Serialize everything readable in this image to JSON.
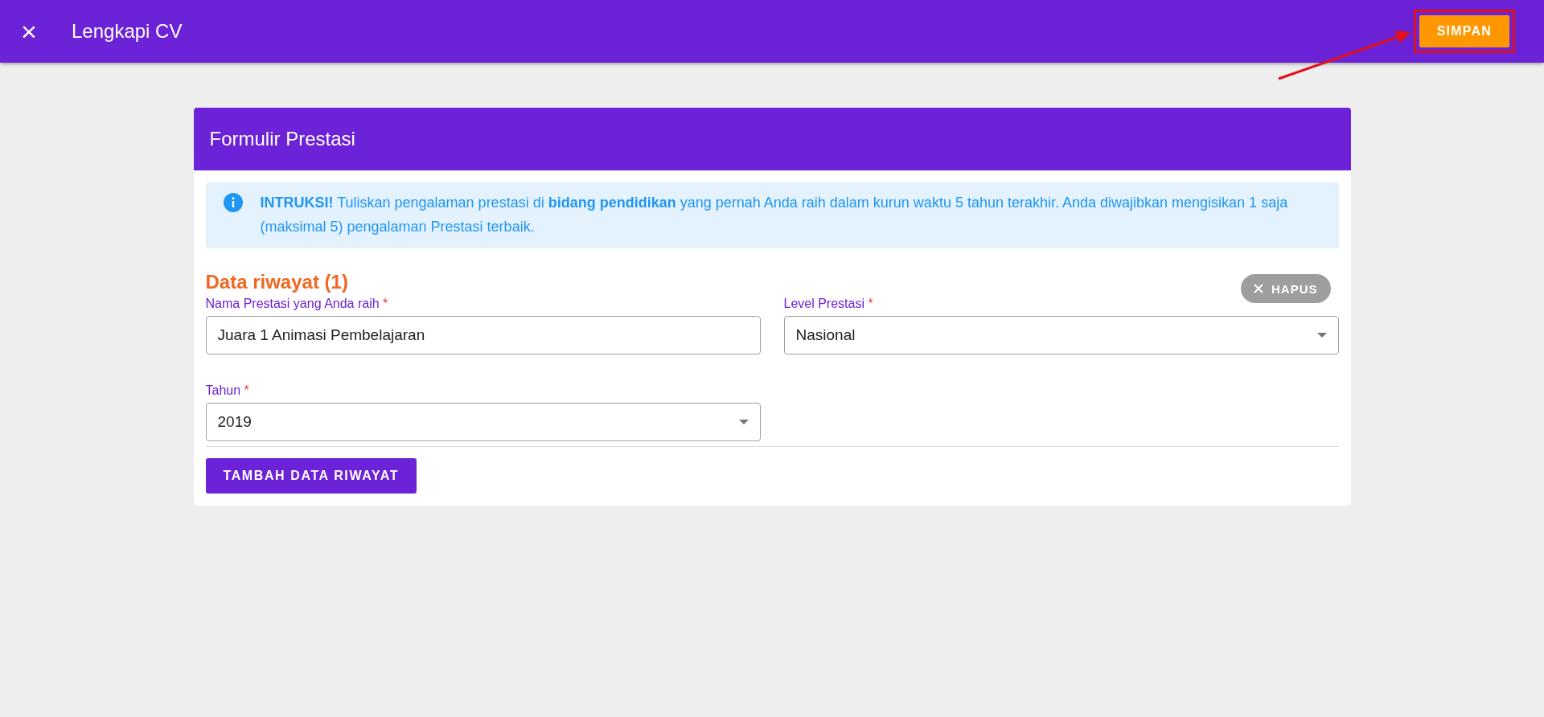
{
  "app_bar": {
    "close_icon": "×",
    "title": "Lengkapi CV",
    "save_button": "SIMPAN",
    "save_highlighted": true
  },
  "card": {
    "title": "Formulir Prestasi",
    "instruction": "**INTRUKSI!** Tuliskan pengalaman prestasi di **bidang pendidikan** yang pernah Anda raih dalam kurun waktu 5 tahun terakhir. Anda diwajibkan mengisikan 1 saja (maksimal 5) pengalaman Prestasi terbaik.",
    "entries": [
      {
        "heading": "Data riwayat (1)",
        "delete_button": "HAPUS",
        "fields": [
          {
            "kind": "text",
            "label": "Nama Prestasi yang Anda raih",
            "required_mark": "*",
            "value": "Juara 1 Animasi Pembelajaran"
          },
          {
            "kind": "select",
            "label": "Level Prestasi",
            "required_mark": "*",
            "value": "Nasional"
          },
          {
            "kind": "select",
            "label": "Tahun",
            "required_mark": "*",
            "value": "2019"
          }
        ]
      }
    ],
    "add_button": "TAMBAH DATA RIWAYAT"
  }
}
